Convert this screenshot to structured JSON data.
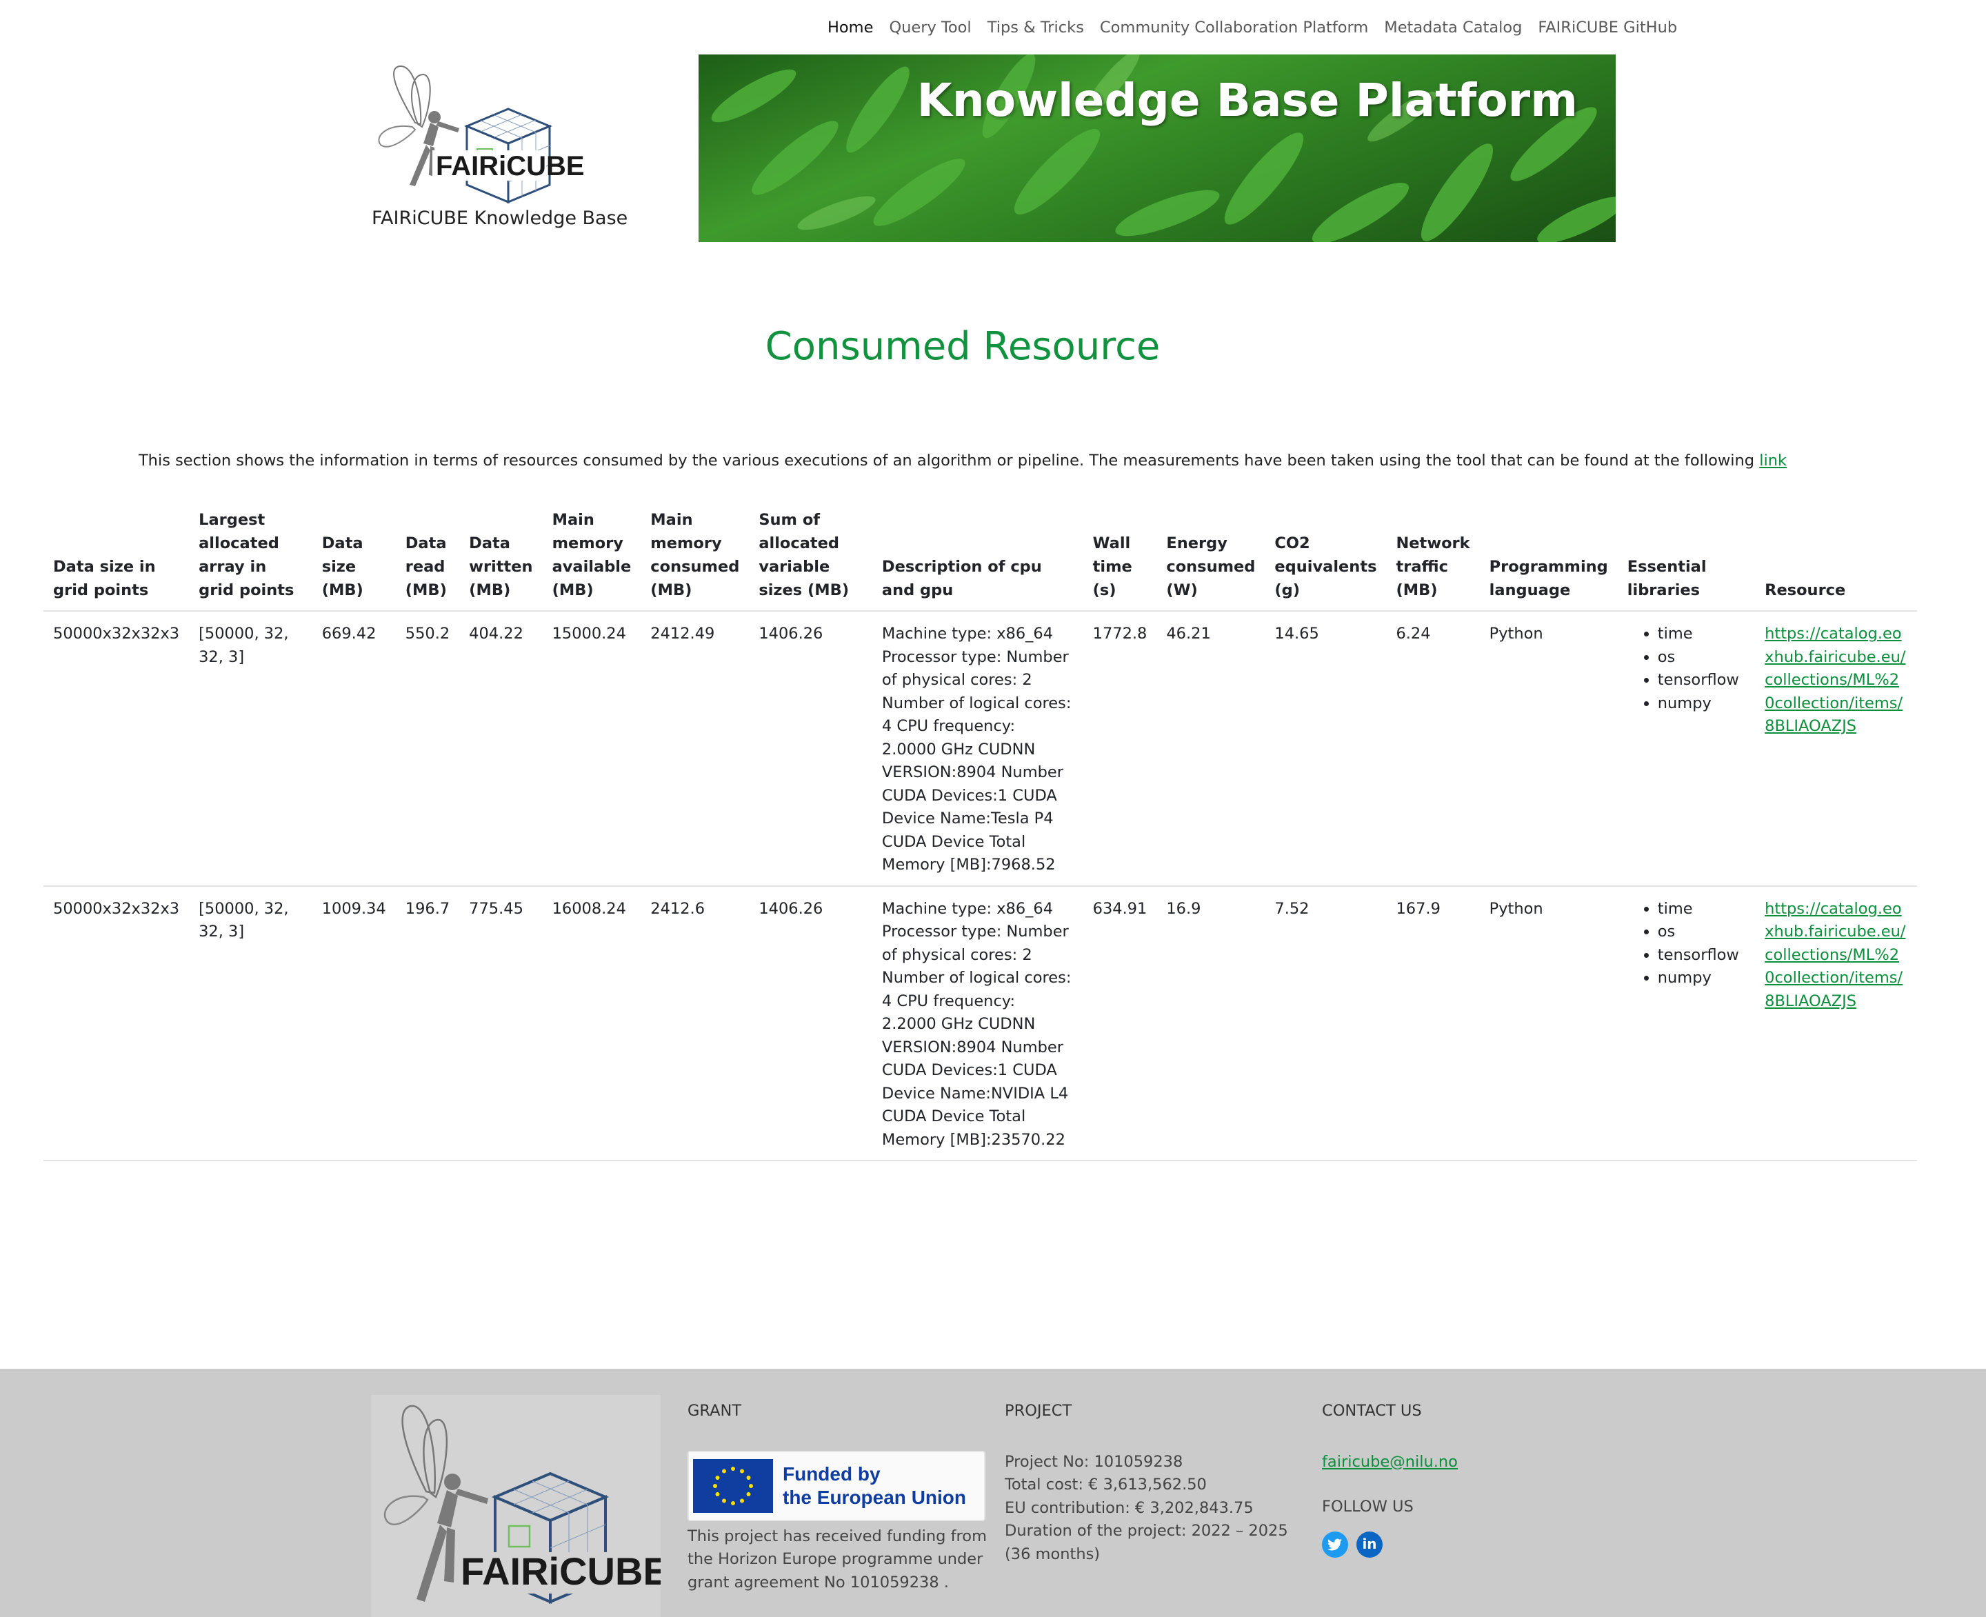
{
  "nav": {
    "items": [
      {
        "label": "Home",
        "active": true
      },
      {
        "label": "Query Tool"
      },
      {
        "label": "Tips & Tricks"
      },
      {
        "label": "Community Collaboration Platform"
      },
      {
        "label": "Metadata Catalog"
      },
      {
        "label": "FAIRiCUBE GitHub"
      }
    ]
  },
  "header": {
    "logo_text": "FAIRiCUBE",
    "caption": "FAIRiCUBE Knowledge Base",
    "banner_title": "Knowledge Base Platform"
  },
  "page": {
    "title": "Consumed Resource",
    "intro": "This section shows the information in terms of resources consumed by the various executions of an algorithm or pipeline. The measurements have been taken using the tool that can be found at the following",
    "intro_link": "link"
  },
  "table": {
    "headers": [
      "Data size in grid points",
      "Largest allocated array in grid points",
      "Data size (MB)",
      "Data read (MB)",
      "Data written (MB)",
      "Main memory available (MB)",
      "Main memory consumed (MB)",
      "Sum of allocated variable sizes (MB)",
      "Description of cpu and gpu",
      "Wall time (s)",
      "Energy consumed (W)",
      "CO2 equivalents (g)",
      "Network traffic (MB)",
      "Programming language",
      "Essential libraries",
      "Resource"
    ],
    "rows": [
      {
        "grid_points": "50000x32x32x3",
        "largest_array": "[50000, 32, 32, 3]",
        "data_size": "669.42",
        "data_read": "550.2",
        "data_written": "404.22",
        "mem_available": "15000.24",
        "mem_consumed": "2412.49",
        "sum_vars": "1406.26",
        "cpu_gpu": "Machine type: x86_64 Processor type: Number of physical cores: 2 Number of logical cores: 4 CPU frequency: 2.0000 GHz CUDNN VERSION:8904 Number CUDA Devices:1 CUDA Device Name:Tesla P4 CUDA Device Total Memory [MB]:7968.52",
        "wall_time": "1772.8",
        "energy": "46.21",
        "co2": "14.65",
        "network": "6.24",
        "language": "Python",
        "libraries": [
          "time",
          "os",
          "tensorflow",
          "numpy"
        ],
        "resource": "https://catalog.eoxhub.fairicube.eu/collections/ML%20collection/items/8BLIAOAZJS"
      },
      {
        "grid_points": "50000x32x32x3",
        "largest_array": "[50000, 32, 32, 3]",
        "data_size": "1009.34",
        "data_read": "196.7",
        "data_written": "775.45",
        "mem_available": "16008.24",
        "mem_consumed": "2412.6",
        "sum_vars": "1406.26",
        "cpu_gpu": "Machine type: x86_64 Processor type: Number of physical cores: 2 Number of logical cores: 4 CPU frequency: 2.2000 GHz CUDNN VERSION:8904 Number CUDA Devices:1 CUDA Device Name:NVIDIA L4 CUDA Device Total Memory [MB]:23570.22",
        "wall_time": "634.91",
        "energy": "16.9",
        "co2": "7.52",
        "network": "167.9",
        "language": "Python",
        "libraries": [
          "time",
          "os",
          "tensorflow",
          "numpy"
        ],
        "resource": "https://catalog.eoxhub.fairicube.eu/collections/ML%20collection/items/8BLIAOAZJS"
      }
    ]
  },
  "footer": {
    "logo_text": "FAIRiCUBE",
    "grant": {
      "heading": "GRANT",
      "badge_line1": "Funded by",
      "badge_line2": "the European Union",
      "text": "This project has received funding from the Horizon Europe programme under grant agreement No 101059238 ."
    },
    "project": {
      "heading": "PROJECT",
      "lines": [
        "Project No: 101059238",
        "Total cost: € 3,613,562.50",
        "EU contribution: € 3,202,843.75",
        "Duration of the project: 2022 – 2025 (36 months)"
      ]
    },
    "contact": {
      "heading": "CONTACT US",
      "email": "fairicube@nilu.no",
      "follow": "FOLLOW US"
    }
  },
  "colors": {
    "accent": "#11923f",
    "link": "#0b8f3c",
    "footer_bg": "#cbcbcb",
    "eu_blue": "#0f3ea0"
  }
}
